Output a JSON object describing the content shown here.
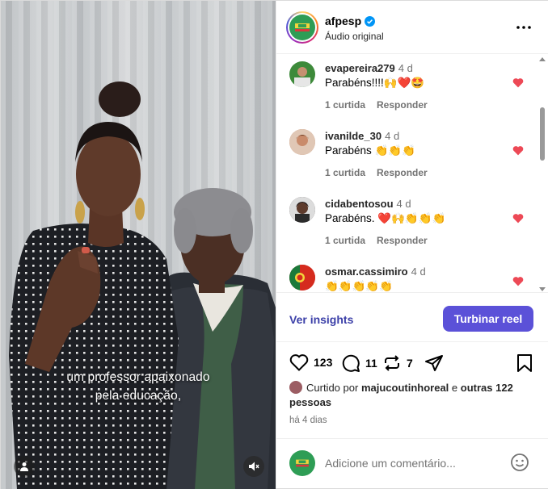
{
  "video": {
    "subtitle_line1": "um professor apaixonado",
    "subtitle_line2": "pela educação,"
  },
  "header": {
    "username": "afpesp",
    "audio": "Áudio original",
    "more_icon": "more-icon"
  },
  "comments": [
    {
      "user": "evapereira279",
      "time": "4 d",
      "text": "Parabéns!!!!🙌❤️🤩",
      "likes": "1 curtida",
      "reply": "Responder",
      "avatar_color": "#3d8a3a"
    },
    {
      "user": "ivanilde_30",
      "time": "4 d",
      "text": "Parabéns 👏👏👏",
      "likes": "1 curtida",
      "reply": "Responder",
      "avatar_color": "#c98b6b"
    },
    {
      "user": "cidabentosou",
      "time": "4 d",
      "text": "Parabéns. ❤️🙌👏👏👏",
      "likes": "1 curtida",
      "reply": "Responder",
      "avatar_color": "#3a3030"
    },
    {
      "user": "osmar.cassimiro",
      "time": "4 d",
      "text": "👏👏👏👏👏",
      "likes": "",
      "reply": "",
      "avatar_color": "#c0302a"
    }
  ],
  "insights": {
    "link": "Ver insights",
    "boost": "Turbinar reel"
  },
  "actions": {
    "likes_count": "123",
    "comments_count": "11",
    "reposts_count": "7"
  },
  "liked_by": {
    "prefix": "Curtido por",
    "user": "majucoutinhoreal",
    "connector": "e",
    "others": "outras 122 pessoas"
  },
  "timestamp": "há 4 dias",
  "add_comment": {
    "placeholder": "Adicione um comentário..."
  },
  "colors": {
    "accent": "#5b51d8",
    "link": "#3b3fa8",
    "heart": "#ed4956",
    "brand_green": "#2e9d55",
    "verified": "#0095f6"
  }
}
